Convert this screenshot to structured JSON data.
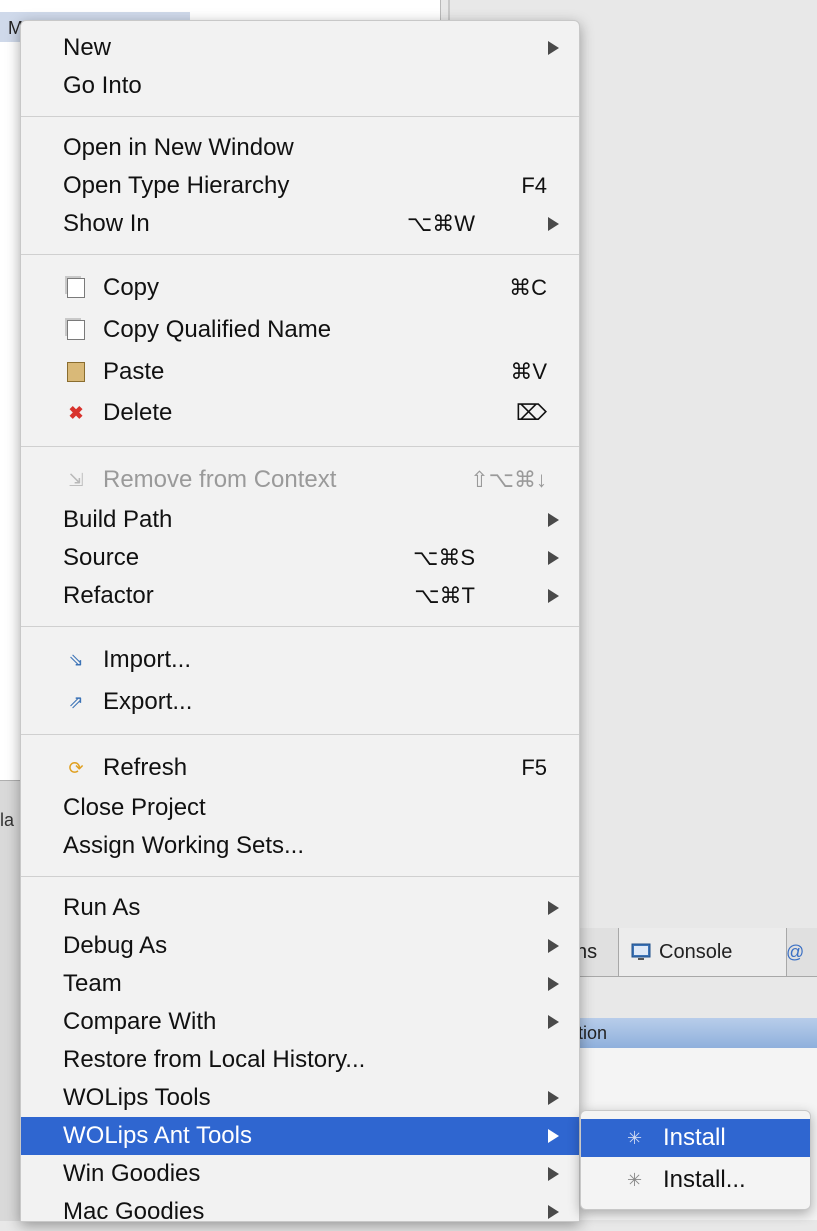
{
  "background": {
    "selected_item_text": "M",
    "lower_left_label": "la",
    "tabs": {
      "problems_fragment": "ns",
      "console_label": "Console",
      "at_label": "@"
    },
    "table_header_fragment": "tion"
  },
  "menu": {
    "items": [
      {
        "label": "New",
        "submenu": true
      },
      {
        "label": "Go Into"
      },
      {
        "label": "Open in New Window"
      },
      {
        "label": "Open Type Hierarchy",
        "shortcut": "F4"
      },
      {
        "label": "Show In",
        "shortcut": "⌥⌘W",
        "submenu": true
      },
      {
        "label": "Copy",
        "shortcut": "⌘C",
        "icon": "copy-icon"
      },
      {
        "label": "Copy Qualified Name",
        "icon": "copy-qualified-name-icon"
      },
      {
        "label": "Paste",
        "shortcut": "⌘V",
        "icon": "paste-icon"
      },
      {
        "label": "Delete",
        "shortcut": "⌦",
        "icon": "delete-icon"
      },
      {
        "label": "Remove from Context",
        "shortcut": "⇧⌥⌘↓",
        "icon": "remove-context-icon",
        "disabled": true
      },
      {
        "label": "Build Path",
        "submenu": true
      },
      {
        "label": "Source",
        "shortcut": "⌥⌘S",
        "submenu": true
      },
      {
        "label": "Refactor",
        "shortcut": "⌥⌘T",
        "submenu": true
      },
      {
        "label": "Import...",
        "icon": "import-icon"
      },
      {
        "label": "Export...",
        "icon": "export-icon"
      },
      {
        "label": "Refresh",
        "shortcut": "F5",
        "icon": "refresh-icon"
      },
      {
        "label": "Close Project"
      },
      {
        "label": "Assign Working Sets..."
      },
      {
        "label": "Run As",
        "submenu": true
      },
      {
        "label": "Debug As",
        "submenu": true
      },
      {
        "label": "Team",
        "submenu": true
      },
      {
        "label": "Compare With",
        "submenu": true
      },
      {
        "label": "Restore from Local History..."
      },
      {
        "label": "WOLips Tools",
        "submenu": true
      },
      {
        "label": "WOLips Ant Tools",
        "submenu": true,
        "highlighted": true
      },
      {
        "label": "Win Goodies",
        "submenu": true
      },
      {
        "label": "Mac Goodies",
        "submenu": true
      }
    ]
  },
  "submenu": {
    "items": [
      {
        "label": "Install",
        "highlighted": true,
        "icon": "ant-icon"
      },
      {
        "label": "Install...",
        "icon": "ant-icon"
      }
    ]
  },
  "colors": {
    "highlight": "#2f66d0",
    "menu_bg": "#f2f2f2",
    "delete_icon": "#d8322c"
  }
}
